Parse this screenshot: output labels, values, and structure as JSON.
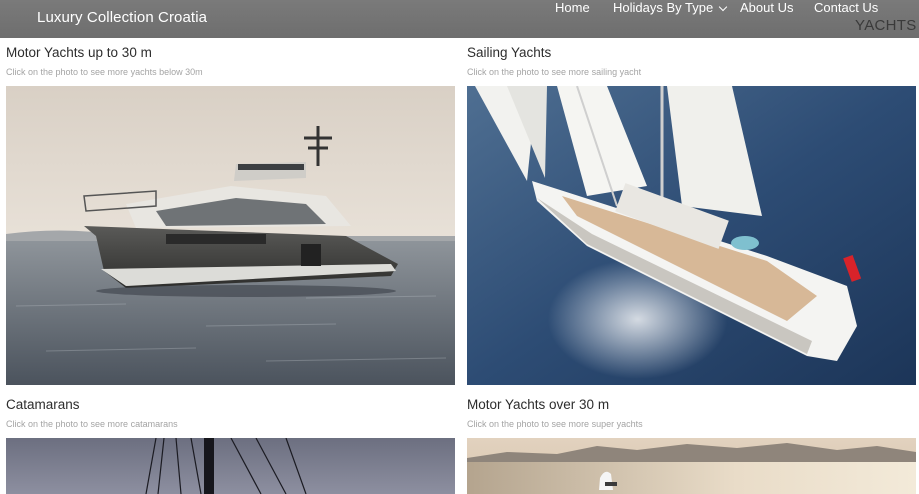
{
  "header": {
    "brand": "Luxury Collection Croatia",
    "nav": [
      {
        "label": "Home"
      },
      {
        "label": "Holidays By Type"
      },
      {
        "label": "About Us"
      },
      {
        "label": "Contact Us"
      }
    ],
    "overlay_label": "YACHTS"
  },
  "cards": [
    {
      "title": "Motor Yachts up to 30 m",
      "subtitle": "Click on the photo to see more yachts below 30m",
      "image": "motor-yacht-photo"
    },
    {
      "title": "Sailing Yachts",
      "subtitle": "Click on the photo to see more sailing yacht",
      "image": "sailing-yacht-photo"
    },
    {
      "title": "Catamarans",
      "subtitle": "Click on the photo to see more catamarans",
      "image": "catamaran-photo"
    },
    {
      "title": "Motor Yachts over 30 m",
      "subtitle": "Click on the photo to see more super yachts",
      "image": "super-yacht-photo"
    }
  ],
  "colors": {
    "header_bg": "#737373",
    "nav_text": "#ffffff",
    "title_text": "#2d2d2d",
    "subtitle_text": "#a4a4a4"
  }
}
